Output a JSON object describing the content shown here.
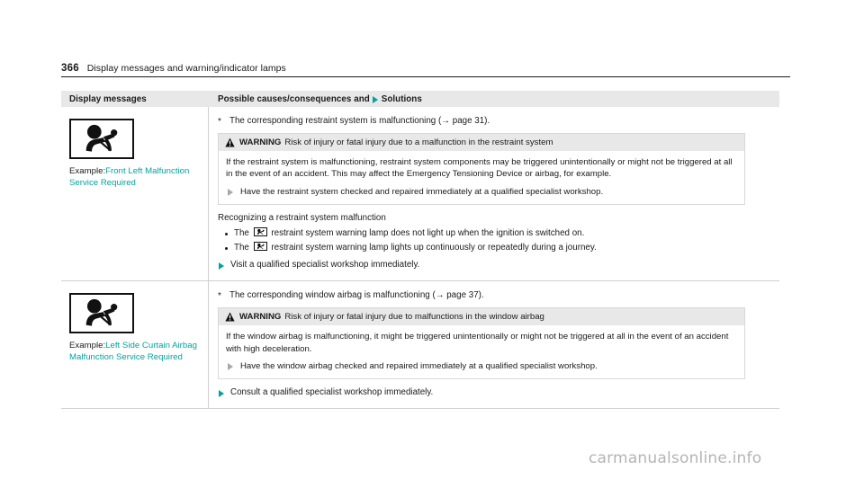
{
  "running_head": {
    "page_number": "366",
    "title": "Display messages and warning/indicator lamps"
  },
  "table": {
    "header": {
      "col1": "Display messages",
      "col2_prefix": "Possible causes/consequences and",
      "col2_suffix": "Solutions"
    },
    "rows": [
      {
        "lamp_icon": "restraint-system-warning-lamp-icon",
        "example_label": "Example:",
        "example_message": "Front Left Malfunction Service Required",
        "cause": "The corresponding restraint system is malfunctioning (→ page 31).",
        "warning": {
          "word": "WARNING",
          "headline": "Risk of injury or fatal injury due to a malfunction in the restraint system",
          "body": "If the restraint system is malfunctioning, restraint system components may be triggered unintentionally or might not be triggered at all in the event of an accident. This may affect the Emergency Tensioning Device or airbag, for example.",
          "action": "Have the restraint system checked and repaired immediately at a qualified specialist workshop."
        },
        "section_title": "Recognizing a restraint system malfunction",
        "bullets": [
          {
            "before": "The",
            "after": "restraint system warning lamp does not light up when the ignition is switched on."
          },
          {
            "before": "The",
            "after": "restraint system warning lamp lights up continuously or repeatedly during a journey."
          }
        ],
        "solution": "Visit a qualified specialist workshop immediately."
      },
      {
        "lamp_icon": "restraint-system-warning-lamp-icon",
        "example_label": "Example:",
        "example_message": "Left Side Curtain Airbag Malfunction Service Required",
        "cause": "The corresponding window airbag is malfunctioning (→ page 37).",
        "warning": {
          "word": "WARNING",
          "headline": "Risk of injury or fatal injury due to malfunctions in the window airbag",
          "body": "If the window airbag is malfunctioning, it might be triggered unintentionally or might not be triggered at all in the event of an accident with high deceleration.",
          "action": "Have the window airbag checked and repaired immediately at a qualified specialist workshop."
        },
        "section_title": "",
        "bullets": [],
        "solution": "Consult a qualified specialist workshop immediately."
      }
    ]
  },
  "watermark": "carmanualsonline.info",
  "colors": {
    "accent_teal": "#00a3a0",
    "header_band": "#e8e8e8",
    "rule": "#cfcfcf",
    "text": "#1a1a1a",
    "watermark": "#b4b4b4"
  }
}
